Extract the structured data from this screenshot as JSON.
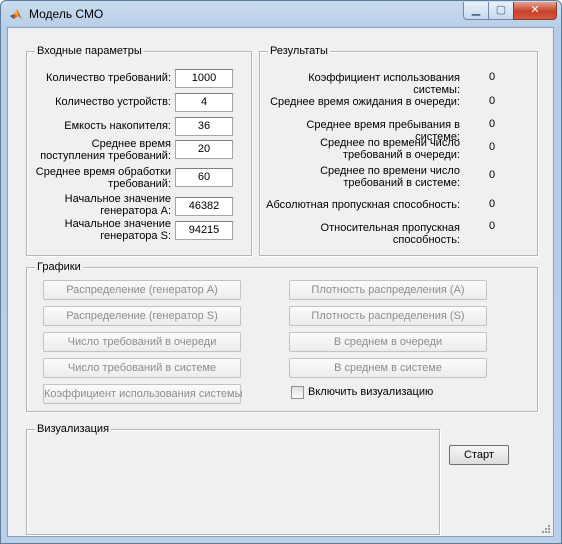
{
  "window": {
    "title": "Модель СМО",
    "controls": {
      "minimize": "▁",
      "maximize": "▢",
      "close": "✕"
    }
  },
  "inputs": {
    "title": "Входные параметры",
    "fields": [
      {
        "label": "Количество требований:",
        "value": "1000"
      },
      {
        "label": "Количество устройств:",
        "value": "4"
      },
      {
        "label": "Емкость накопителя:",
        "value": "36"
      },
      {
        "label": "Среднее время поступления требований:",
        "value": "20"
      },
      {
        "label": "Среднее время обработки требований:",
        "value": "60"
      },
      {
        "label": "Начальное значение генератора А:",
        "value": "46382"
      },
      {
        "label": "Начальное значение генератора S:",
        "value": "94215"
      }
    ]
  },
  "results": {
    "title": "Результаты",
    "items": [
      {
        "label": "Коэффициент использования системы:",
        "value": "0"
      },
      {
        "label": "Среднее время ожидания в очереди:",
        "value": "0"
      },
      {
        "label": "Среднее время пребывания в системе:",
        "value": "0"
      },
      {
        "label": "Среднее по времени число требований в очереди:",
        "value": "0"
      },
      {
        "label": "Среднее по времени число требований в системе:",
        "value": "0"
      },
      {
        "label": "Абсолютная пропускная способность:",
        "value": "0"
      },
      {
        "label": "Относительная пропускная способность:",
        "value": "0"
      }
    ]
  },
  "graphs": {
    "title": "Графики",
    "left_buttons": [
      "Распределение (генератор А)",
      "Распределение (генератор S)",
      "Число требований в очереди",
      "Число требований в системе",
      "Коэффициент использования системы"
    ],
    "right_buttons": [
      "Плотность распределения (А)",
      "Плотность распределения (S)",
      "В среднем в очереди",
      "В среднем в системе"
    ],
    "checkbox_label": "Включить визуализацию"
  },
  "visualization": {
    "title": "Визуализация"
  },
  "start_button": "Старт",
  "colors": {
    "panel_bg": "#f0f0f0",
    "frame": "#b9d0e8",
    "disabled_text": "#8d8d8d"
  }
}
